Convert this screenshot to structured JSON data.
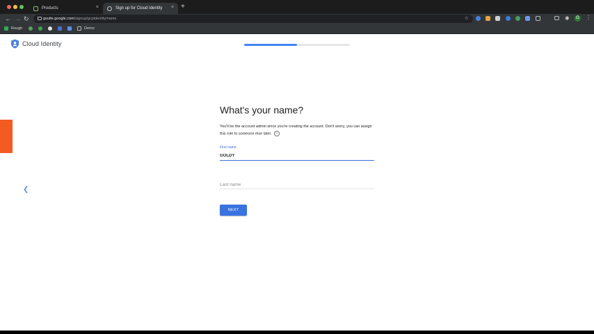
{
  "browser": {
    "tabs": [
      {
        "title": "Products",
        "active": false
      },
      {
        "title": "Sign up for Cloud Identity",
        "active": true
      }
    ],
    "close_glyph": "×",
    "new_tab_glyph": "+",
    "url": {
      "host": "gsuite.google.com",
      "path": "/signup/gcpidentity/name"
    },
    "bookmarks": [
      "Rough",
      "Demo"
    ],
    "avatar_letter": "G",
    "colors": {
      "frame": "#1c1c1c",
      "toolbar": "#333639"
    }
  },
  "page": {
    "brand": "Cloud Identity",
    "progress": 0.5,
    "heading": "What's your name?",
    "description": "You'll be the account admin since you're creating the account. Don't worry, you can assign this role to someone else later.",
    "help_glyph": "?",
    "first_name": {
      "label": "First name",
      "value": "GOLDY"
    },
    "last_name": {
      "placeholder": "Last name",
      "value": ""
    },
    "next_button": "NEXT",
    "colors": {
      "accent": "#4285f4",
      "button": "#3a73e0",
      "side_tab": "#f35b22"
    }
  }
}
